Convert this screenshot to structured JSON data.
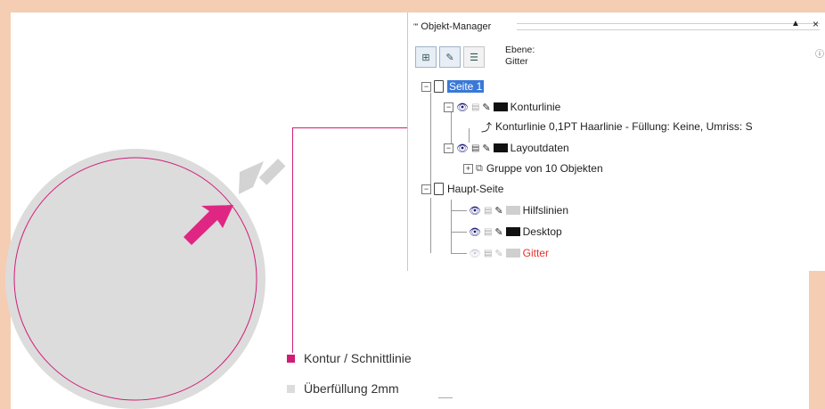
{
  "panel": {
    "title": "Objekt-Manager",
    "grip": "\"\"",
    "up_button": "▲",
    "close_button": "×",
    "info_button": "ⓘ",
    "layer_label": "Ebene:",
    "layer_value": "Gitter"
  },
  "tree": {
    "page1": "Seite 1",
    "konturlinie": "Konturlinie",
    "konturlinie_object": "Konturlinie 0,1PT Haarlinie - Füllung: Keine, Umriss: S",
    "layoutdaten": "Layoutdaten",
    "gruppe": "Gruppe von 10 Objekten",
    "hauptseite": "Haupt-Seite",
    "hilfslinien": "Hilfslinien",
    "desktop": "Desktop",
    "gitter": "Gitter"
  },
  "legend": {
    "kontur": "Kontur / Schnittlinie",
    "ueberfuellung": "Überfüllung 2mm"
  },
  "colors": {
    "background": "#f5cdb3",
    "magenta": "#d01d75",
    "bleed_gray": "#dcdcdc",
    "selection_blue": "#3a78d8",
    "gitter_red": "#e0322f"
  }
}
